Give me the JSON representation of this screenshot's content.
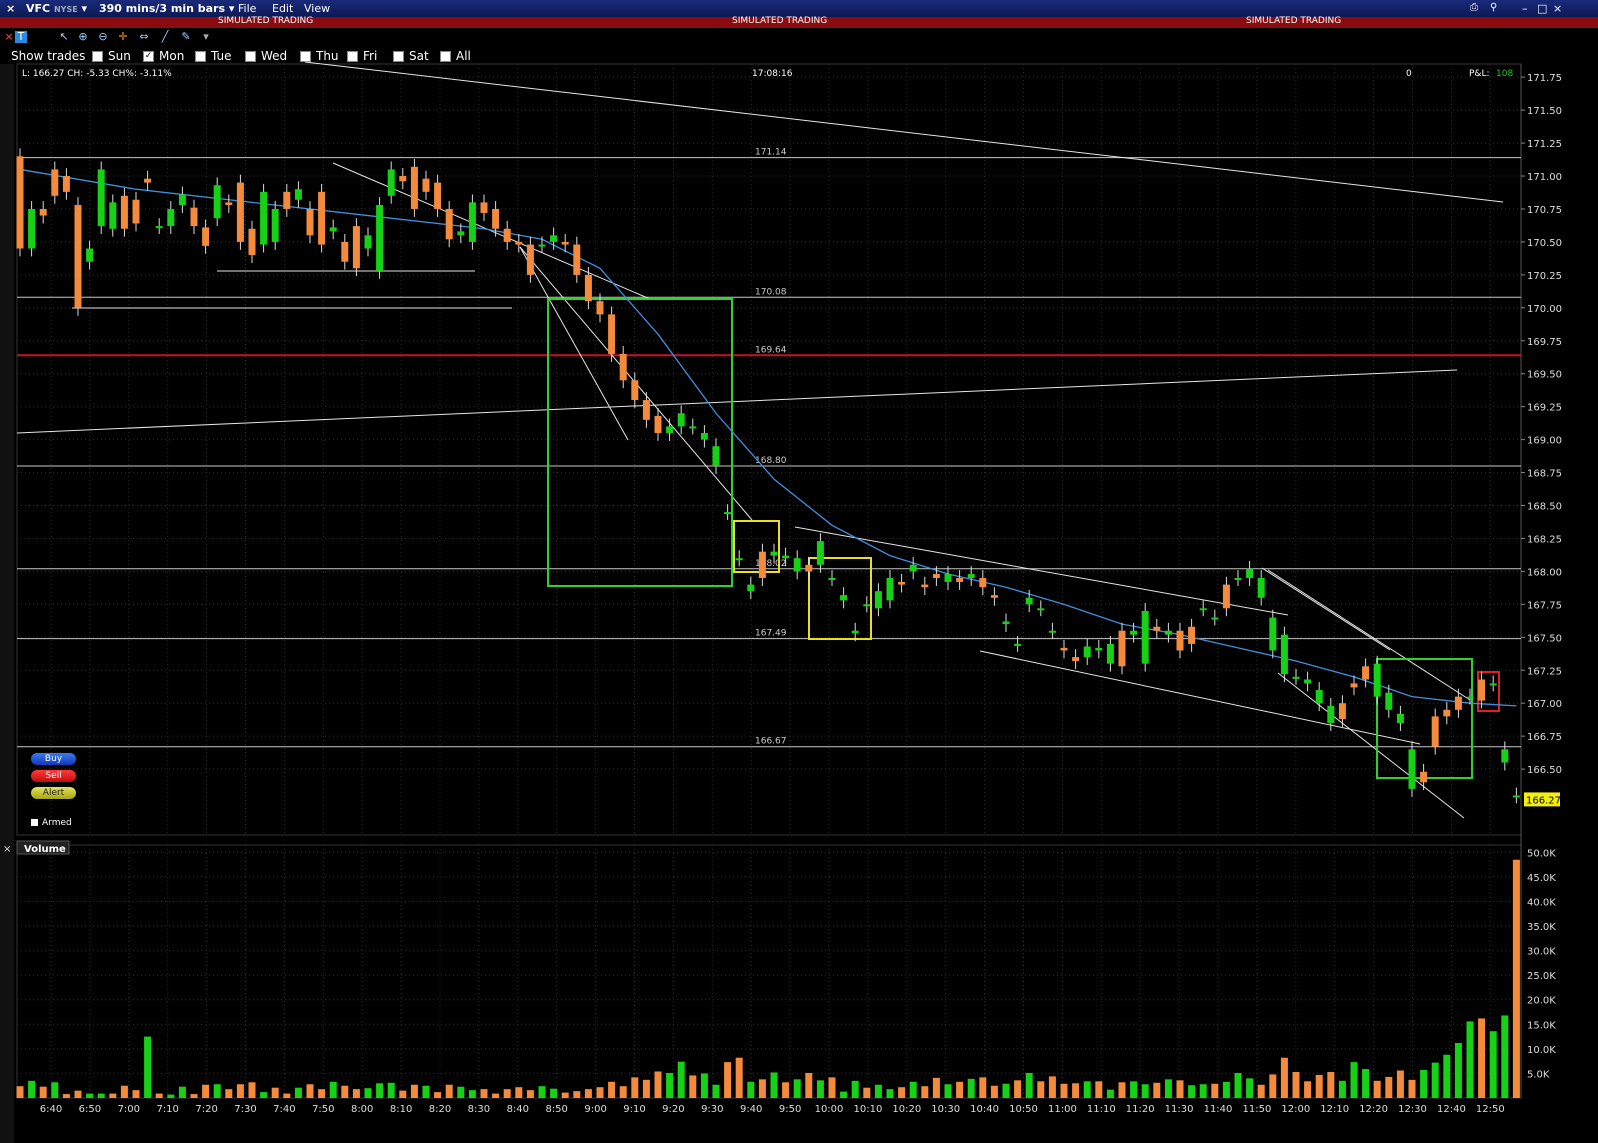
{
  "window": {
    "symbol": "VFC",
    "exchange": "NYSE",
    "timeframe": "390 mins/3 min bars",
    "menus": [
      "File",
      "Edit",
      "View"
    ]
  },
  "banner": {
    "text": "SIMULATED TRADING"
  },
  "toolbar": {
    "show_trades_label": "Show trades"
  },
  "days": [
    {
      "label": "Sun",
      "checked": false
    },
    {
      "label": "Mon",
      "checked": true
    },
    {
      "label": "Tue",
      "checked": false
    },
    {
      "label": "Wed",
      "checked": false
    },
    {
      "label": "Thu",
      "checked": false
    },
    {
      "label": "Fri",
      "checked": false
    },
    {
      "label": "Sat",
      "checked": false
    },
    {
      "label": "All",
      "checked": false
    }
  ],
  "info": {
    "quote": "L: 166.27  CH: -5.33  CH%: -3.11%",
    "time": "17:08:16",
    "position": "0",
    "pnl_label": "P&L:",
    "pnl_value": "108"
  },
  "order_buttons": {
    "buy": "Buy",
    "sell": "Sell",
    "alert": "Alert",
    "armed": "Armed"
  },
  "volume_panel": {
    "title": "Volume"
  },
  "colors": {
    "up": "#17d117",
    "down": "#f48a3c",
    "ma": "#3f8fde",
    "level": "#c8c8c8",
    "red_level": "#c8102e",
    "box_green": "#2fd12f",
    "box_yellow": "#e8e020",
    "box_red": "#e02020",
    "last_price_bg": "#f2ee10"
  },
  "chart_data": [
    {
      "type": "candlestick",
      "title": "VFC 3 min bars",
      "x_labels": [
        "6:40",
        "6:50",
        "7:00",
        "7:10",
        "7:20",
        "7:30",
        "7:40",
        "7:50",
        "8:00",
        "8:10",
        "8:20",
        "8:30",
        "8:40",
        "8:50",
        "9:00",
        "9:10",
        "9:20",
        "9:30",
        "9:40",
        "9:50",
        "10:00",
        "10:10",
        "10:20",
        "10:30",
        "10:40",
        "10:50",
        "11:00",
        "11:10",
        "11:20",
        "11:30",
        "11:40",
        "11:50",
        "12:00",
        "12:10",
        "12:20",
        "12:30",
        "12:40",
        "12:50"
      ],
      "y_ticks": [
        "171.75",
        "171.50",
        "171.25",
        "171.00",
        "170.75",
        "170.50",
        "170.25",
        "170.00",
        "169.75",
        "169.50",
        "169.25",
        "169.00",
        "168.75",
        "168.50",
        "168.25",
        "168.00",
        "167.75",
        "167.50",
        "167.25",
        "167.00",
        "166.75",
        "166.50"
      ],
      "ylim": [
        166.0,
        171.85
      ],
      "last_price": "166.27",
      "levels": [
        {
          "label": "171.14",
          "price": 171.14
        },
        {
          "label": "170.08",
          "price": 170.08
        },
        {
          "label": "169.64",
          "price": 169.64,
          "color": "red"
        },
        {
          "label": "168.80",
          "price": 168.8
        },
        {
          "label": "168.02",
          "price": 168.02
        },
        {
          "label": "167.49",
          "price": 167.49
        },
        {
          "label": "166.67",
          "price": 166.67
        }
      ],
      "series": [
        {
          "name": "VFC",
          "x": [
            0,
            1,
            2,
            3,
            4,
            5,
            6,
            7,
            8,
            9,
            10,
            11,
            12,
            13,
            14,
            15,
            16,
            17,
            18,
            19,
            20,
            21,
            22,
            23,
            24,
            25,
            26,
            27,
            28,
            29,
            30,
            31,
            32,
            33,
            34,
            35,
            36,
            37,
            38,
            39,
            40,
            41,
            42,
            43,
            44,
            45,
            46,
            47,
            48,
            49,
            50,
            51,
            52,
            53,
            54,
            55,
            56,
            57,
            58,
            59,
            60,
            61,
            62,
            63,
            64,
            65,
            66,
            67,
            68,
            69,
            70,
            71,
            72,
            73,
            74,
            75,
            76,
            77,
            78,
            79,
            80,
            81,
            82,
            83,
            84,
            85,
            86,
            87,
            88,
            89,
            90,
            91,
            92,
            93,
            94,
            95,
            96,
            97,
            98,
            99,
            100,
            101,
            102,
            103,
            104,
            105,
            106,
            107,
            108,
            109,
            110,
            111,
            112,
            113,
            114,
            115,
            116,
            117,
            118,
            119,
            120,
            121,
            122,
            123,
            124,
            125,
            126,
            127,
            128,
            129
          ],
          "open": [
            171.15,
            170.45,
            170.75,
            171.05,
            171.0,
            170.78,
            170.35,
            170.62,
            170.6,
            170.85,
            170.82,
            170.98,
            170.62,
            170.62,
            170.78,
            170.76,
            170.61,
            170.68,
            170.8,
            170.95,
            170.6,
            170.48,
            170.5,
            170.88,
            170.82,
            170.75,
            170.88,
            170.58,
            170.5,
            170.62,
            170.45,
            170.28,
            170.85,
            171.0,
            171.07,
            170.98,
            170.95,
            170.75,
            170.55,
            170.5,
            170.8,
            170.75,
            170.6,
            170.5,
            170.48,
            170.48,
            170.5,
            170.5,
            170.48,
            170.25,
            170.05,
            169.95,
            169.65,
            169.45,
            169.3,
            169.18,
            169.05,
            169.1,
            169.1,
            169.0,
            168.8,
            168.45,
            168.1,
            167.85,
            168.15,
            168.12,
            168.1,
            168.0,
            168.05,
            168.05,
            167.95,
            167.78,
            167.53,
            167.75,
            167.72,
            167.78,
            167.92,
            168.0,
            167.9,
            167.98,
            167.92,
            167.95,
            167.95,
            167.95,
            167.82,
            167.6,
            167.45,
            167.75,
            167.72,
            167.55,
            167.42,
            167.35,
            167.35,
            167.4,
            167.3,
            167.55,
            167.52,
            167.3,
            167.58,
            167.52,
            167.55,
            167.58,
            167.72,
            167.65,
            167.9,
            167.95,
            167.95,
            167.8,
            167.4,
            167.22,
            167.2,
            167.15,
            167.0,
            166.85,
            167.0,
            167.15,
            167.28,
            167.05,
            166.95,
            166.85,
            166.35,
            166.48,
            166.9,
            166.95,
            167.05,
            167.05,
            167.18,
            167.15,
            166.55,
            166.3
          ],
          "close": [
            170.45,
            170.75,
            170.7,
            170.85,
            170.88,
            170.0,
            170.45,
            171.05,
            170.8,
            170.6,
            170.64,
            170.95,
            170.62,
            170.75,
            170.86,
            170.62,
            170.47,
            170.93,
            170.78,
            170.5,
            170.4,
            170.88,
            170.75,
            170.75,
            170.9,
            170.55,
            170.48,
            170.61,
            170.35,
            170.3,
            170.55,
            170.78,
            171.05,
            170.96,
            170.75,
            170.88,
            170.75,
            170.52,
            170.58,
            170.8,
            170.72,
            170.6,
            170.5,
            170.48,
            170.25,
            170.48,
            170.55,
            170.48,
            170.25,
            170.05,
            169.95,
            169.65,
            169.45,
            169.3,
            169.15,
            169.05,
            169.1,
            169.2,
            169.1,
            169.05,
            168.95,
            168.45,
            168.1,
            167.9,
            167.95,
            168.15,
            168.12,
            168.1,
            168.0,
            168.23,
            167.95,
            167.82,
            167.55,
            167.75,
            167.85,
            167.95,
            167.9,
            168.05,
            167.88,
            167.95,
            167.98,
            167.92,
            167.98,
            167.88,
            167.8,
            167.62,
            167.45,
            167.8,
            167.72,
            167.55,
            167.4,
            167.32,
            167.43,
            167.42,
            167.45,
            167.28,
            167.55,
            167.7,
            167.55,
            167.55,
            167.4,
            167.45,
            167.72,
            167.65,
            167.72,
            167.95,
            168.02,
            167.95,
            167.65,
            167.52,
            167.2,
            167.18,
            167.1,
            166.98,
            166.88,
            167.12,
            167.18,
            167.3,
            167.08,
            166.92,
            166.65,
            166.4,
            166.67,
            166.9,
            166.95,
            167.05,
            167.02,
            167.15,
            166.65,
            166.3
          ]
        },
        {
          "name": "MA",
          "x": [
            0,
            10,
            20,
            30,
            40,
            45,
            50,
            55,
            60,
            65,
            70,
            75,
            80,
            85,
            90,
            95,
            100,
            105,
            110,
            115,
            120,
            125,
            129
          ],
          "values": [
            171.05,
            170.9,
            170.8,
            170.7,
            170.6,
            170.52,
            170.3,
            169.8,
            169.2,
            168.7,
            168.35,
            168.12,
            167.98,
            167.88,
            167.75,
            167.6,
            167.52,
            167.42,
            167.32,
            167.2,
            167.05,
            167.0,
            166.98
          ]
        }
      ]
    },
    {
      "type": "bar",
      "title": "Volume",
      "y_ticks": [
        "50.0K",
        "45.0K",
        "40.0K",
        "35.0K",
        "30.0K",
        "25.0K",
        "20.0K",
        "15.0K",
        "10.0K",
        "5.0K"
      ],
      "ylim": [
        0,
        51500
      ],
      "values": [
        2400,
        3500,
        2300,
        3200,
        800,
        1500,
        900,
        900,
        900,
        2500,
        1600,
        12500,
        900,
        700,
        2300,
        800,
        2700,
        2800,
        1800,
        2800,
        3200,
        1200,
        2100,
        900,
        2100,
        2800,
        1800,
        3300,
        2500,
        1800,
        2000,
        3000,
        3100,
        1500,
        2700,
        2500,
        1200,
        2700,
        2300,
        1600,
        1800,
        900,
        1800,
        2200,
        1600,
        2400,
        1900,
        1100,
        1400,
        1800,
        2200,
        3300,
        2400,
        4200,
        3700,
        5400,
        5100,
        7400,
        4600,
        5000,
        2700,
        7300,
        8200,
        3300,
        3800,
        5200,
        3200,
        3800,
        5100,
        3600,
        4200,
        1300,
        3500,
        2100,
        2700,
        1800,
        2200,
        3300,
        2400,
        4100,
        2800,
        3300,
        3900,
        4200,
        2500,
        2900,
        3600,
        5100,
        3400,
        4400,
        2900,
        3000,
        3400,
        3400,
        1700,
        3200,
        3400,
        2800,
        3100,
        3800,
        3600,
        2600,
        2800,
        2900,
        3300,
        5100,
        4000,
        2700,
        4800,
        8200,
        5300,
        3400,
        4700,
        5300,
        3500,
        7300,
        5900,
        3500,
        4300,
        5600,
        3700,
        5700,
        7200,
        8800,
        11200,
        15600,
        16200,
        13600,
        16800,
        48500
      ],
      "bar_up": [
        false,
        true,
        false,
        true,
        false,
        false,
        true,
        true,
        false,
        false,
        false,
        true,
        false,
        true,
        true,
        false,
        false,
        true,
        false,
        false,
        false,
        true,
        false,
        false,
        true,
        false,
        false,
        true,
        false,
        false,
        true,
        true,
        true,
        false,
        false,
        true,
        false,
        false,
        true,
        true,
        false,
        false,
        false,
        false,
        false,
        true,
        true,
        false,
        false,
        false,
        false,
        false,
        false,
        false,
        false,
        false,
        true,
        true,
        false,
        true,
        true,
        false,
        false,
        true,
        false,
        true,
        false,
        true,
        false,
        true,
        false,
        true,
        true,
        false,
        true,
        true,
        false,
        true,
        false,
        false,
        true,
        false,
        true,
        false,
        false,
        true,
        false,
        true,
        false,
        false,
        false,
        false,
        true,
        false,
        true,
        false,
        true,
        true,
        false,
        true,
        false,
        true,
        true,
        false,
        true,
        true,
        true,
        false,
        false,
        false,
        false,
        false,
        false,
        false,
        true,
        true,
        true,
        false,
        false,
        false,
        false,
        true,
        true,
        true,
        true,
        true,
        false,
        true,
        true,
        false
      ]
    }
  ]
}
